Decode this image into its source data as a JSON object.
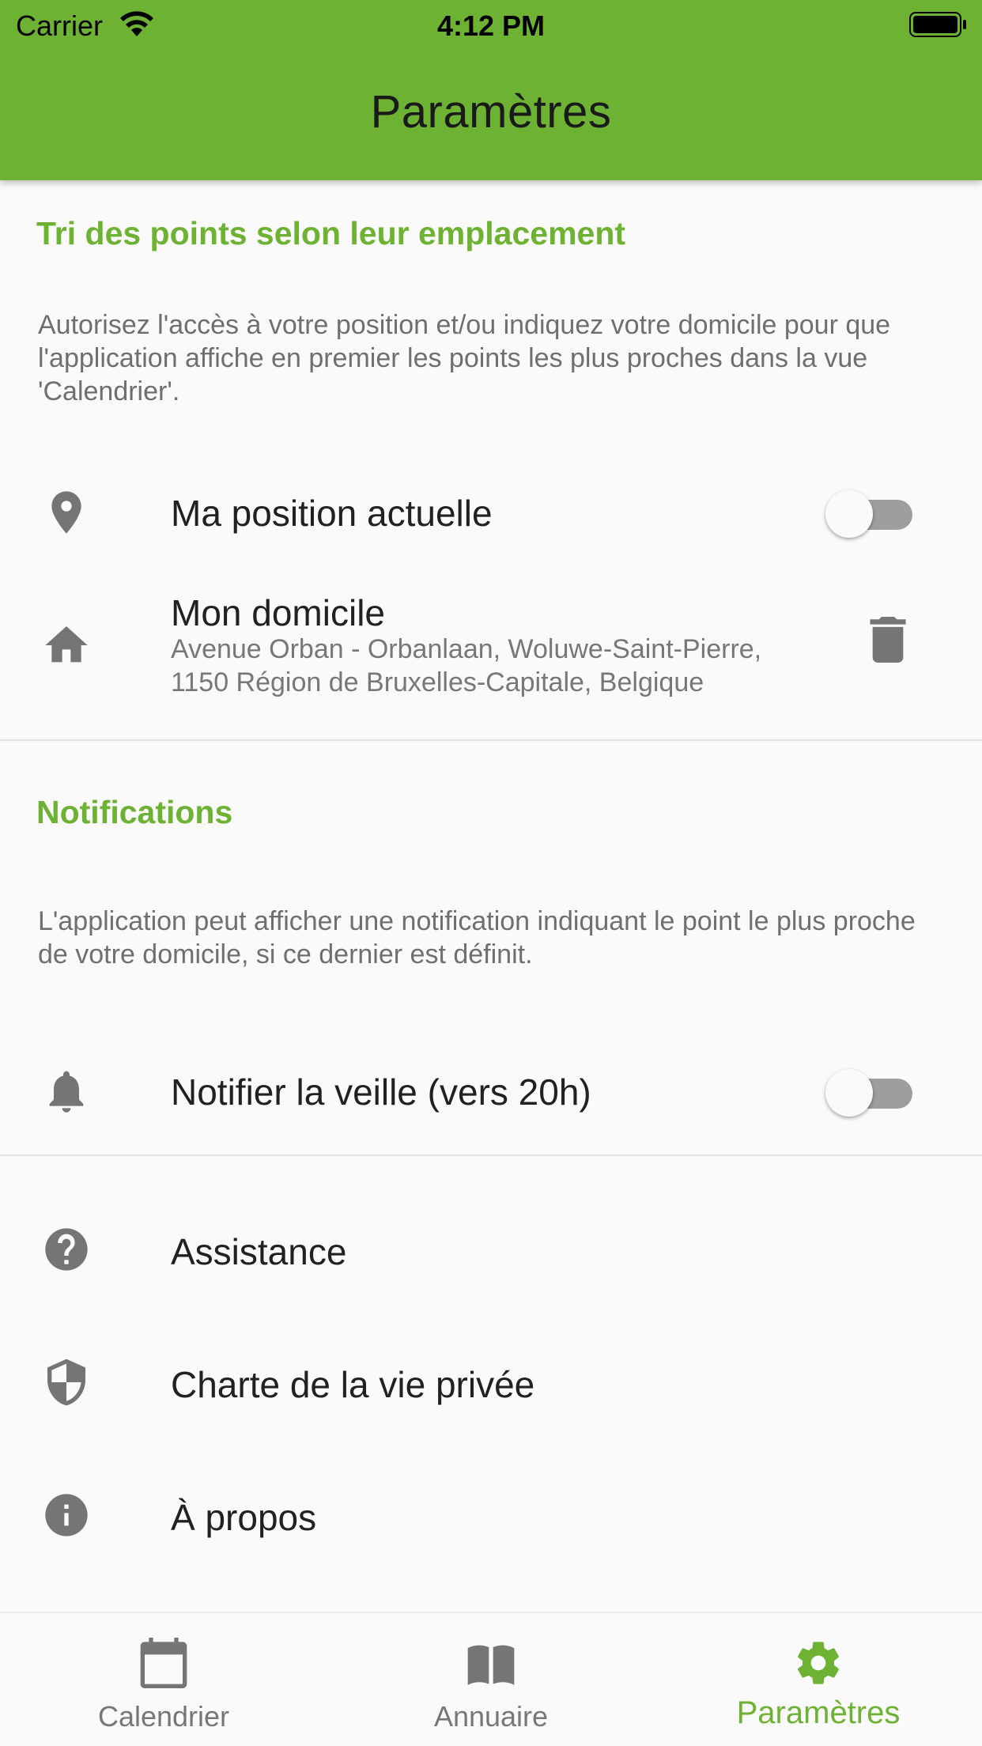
{
  "status_bar": {
    "carrier": "Carrier",
    "time": "4:12 PM"
  },
  "header": {
    "title": "Paramètres"
  },
  "colors": {
    "accent": "#6db233",
    "icon_gray": "#757575",
    "toggle_off_track": "#9e9e9e"
  },
  "location_section": {
    "title": "Tri des points selon leur emplacement",
    "description": "Autorisez l'accès à votre position et/ou indiquez votre domicile pour que l'application affiche en premier les points les plus proches dans la vue 'Calendrier'.",
    "current_position": {
      "label": "Ma position actuelle",
      "icon": "location-pin-icon",
      "enabled": false
    },
    "home": {
      "label": "Mon domicile",
      "address": "Avenue Orban - Orbanlaan, Woluwe-Saint-Pierre, 1150 Région de Bruxelles-Capitale, Belgique",
      "icon": "home-icon",
      "action_icon": "trash-icon"
    }
  },
  "notifications_section": {
    "title": "Notifications",
    "description": "L'application peut afficher une notification indiquant le point le plus proche de votre domicile, si ce dernier est définit.",
    "notify_eve": {
      "label": "Notifier la veille (vers 20h)",
      "icon": "bell-icon",
      "enabled": false
    }
  },
  "links": [
    {
      "label": "Assistance",
      "icon": "help-circle-icon"
    },
    {
      "label": "Charte de la vie privée",
      "icon": "shield-icon"
    },
    {
      "label": "À propos",
      "icon": "info-icon"
    }
  ],
  "bottom_nav": [
    {
      "label": "Calendrier",
      "icon": "calendar-icon",
      "active": false
    },
    {
      "label": "Annuaire",
      "icon": "book-icon",
      "active": false
    },
    {
      "label": "Paramètres",
      "icon": "gear-icon",
      "active": true
    }
  ]
}
